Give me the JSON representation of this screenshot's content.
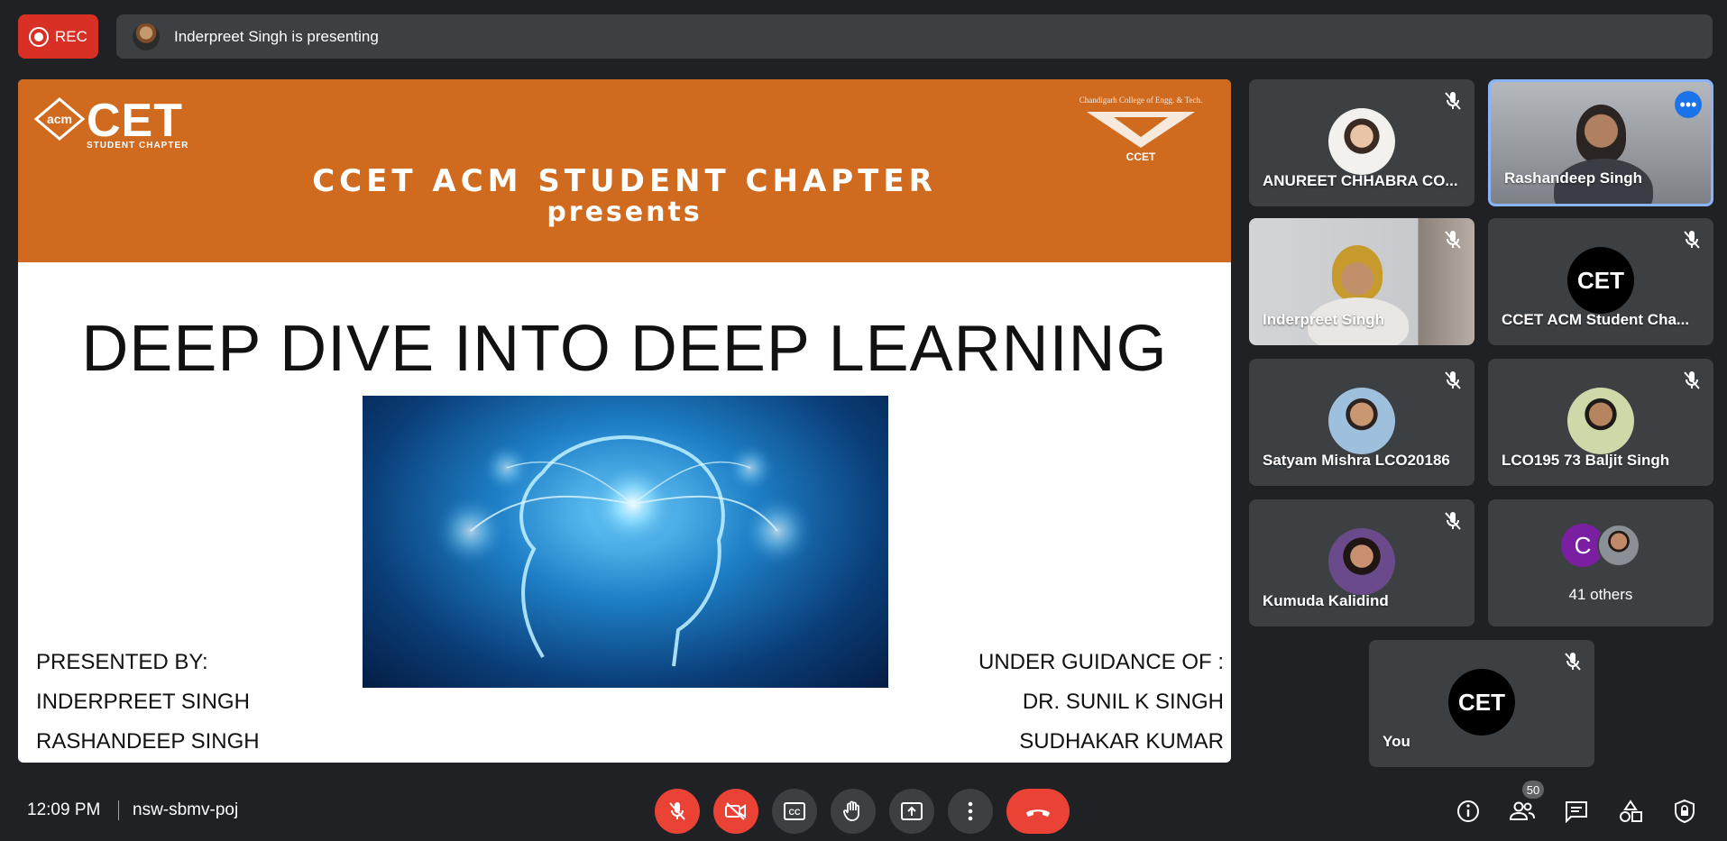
{
  "recording": {
    "label": "REC",
    "color": "#d93025"
  },
  "banner": {
    "text": "Inderpreet Singh is presenting"
  },
  "slide": {
    "logo_left": {
      "text": "CET",
      "caption": "STUDENT CHAPTER",
      "badge": "acm"
    },
    "logo_right": {
      "text": "CCET",
      "arc": "Chandigarh College of Engg. & Tech."
    },
    "header_title": "CCET ACM STUDENT CHAPTER",
    "header_subtitle": "presents",
    "title": "DEEP DIVE INTO DEEP LEARNING",
    "presented_by_label": "PRESENTED BY:",
    "presenters": [
      "INDERPREET SINGH",
      "RASHANDEEP SINGH"
    ],
    "guidance_label": "UNDER GUIDANCE OF :",
    "guides": [
      "DR. SUNIL K SINGH",
      "SUDHAKAR KUMAR"
    ],
    "header_color": "#cf6a1f"
  },
  "participants": [
    {
      "name": "ANUREET CHHABRA CO...",
      "muted": true
    },
    {
      "name": "Rashandeep Singh",
      "muted": false,
      "speaking": true
    },
    {
      "name": "Inderpreet Singh",
      "muted": true
    },
    {
      "name": "CCET ACM Student Cha...",
      "muted": true,
      "avatar_text": "CET"
    },
    {
      "name": "Satyam Mishra LCO20186",
      "muted": true
    },
    {
      "name": "LCO195 73 Baljit Singh",
      "muted": true
    },
    {
      "name": "Kumuda Kalidind",
      "muted": true
    },
    {
      "name": "You",
      "muted": true,
      "avatar_text": "CET"
    }
  ],
  "others": {
    "initial": "C",
    "label": "41 others"
  },
  "more_options_icon": "•••",
  "bottom_bar": {
    "time": "12:09 PM",
    "meeting_code": "nsw-sbmv-poj",
    "people_count": "50"
  },
  "icons": [
    "mic-off-icon",
    "camera-off-icon",
    "captions-icon",
    "raise-hand-icon",
    "present-icon",
    "more-vert-icon",
    "end-call-icon",
    "info-icon",
    "people-icon",
    "chat-icon",
    "activities-icon",
    "host-controls-icon"
  ]
}
